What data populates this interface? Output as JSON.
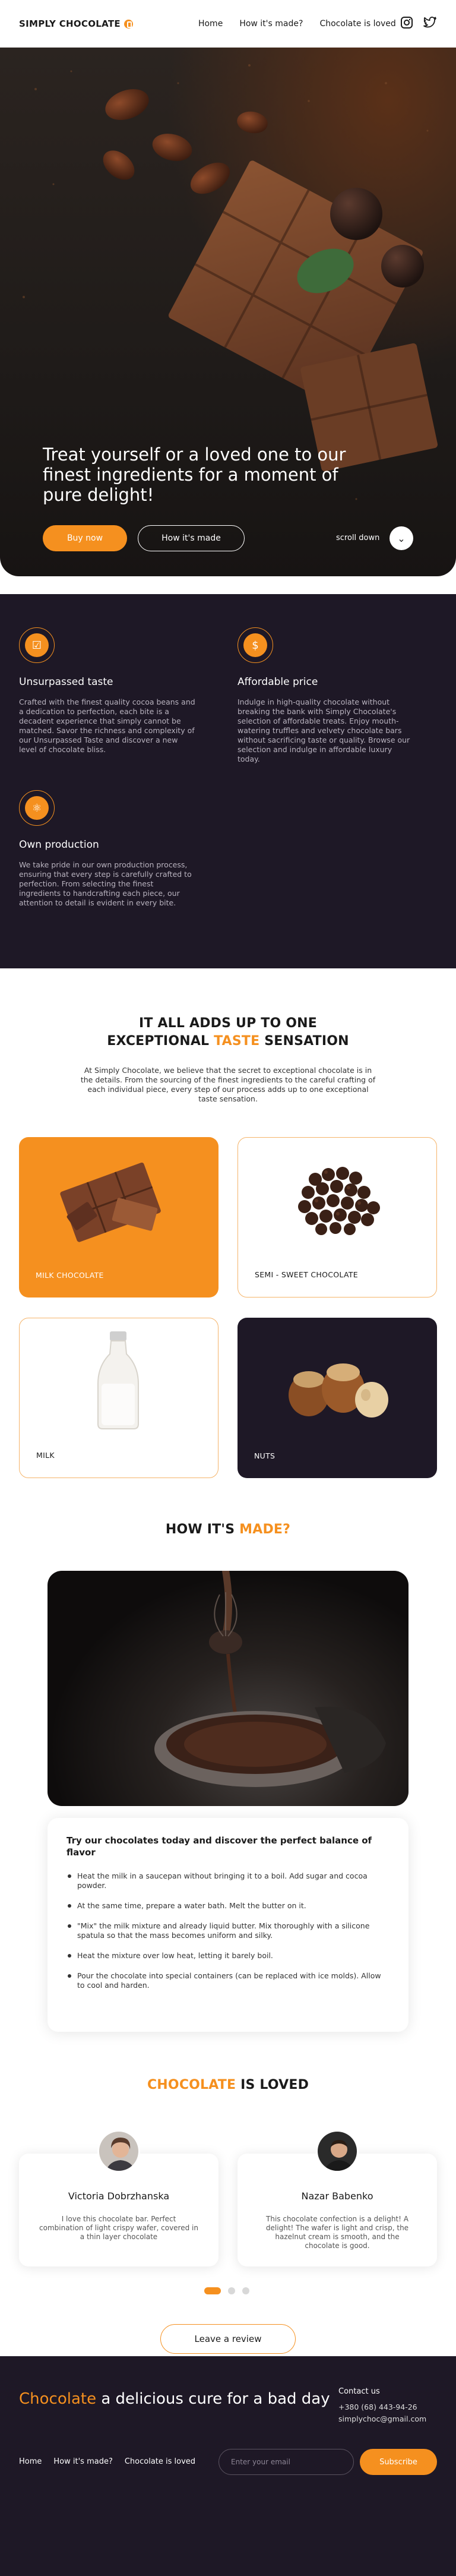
{
  "header": {
    "brand": "SIMPLY CHOCOLATE",
    "nav": [
      "Home",
      "How it's made?",
      "Chocolate is loved"
    ],
    "socials": [
      "instagram-icon",
      "twitter-icon"
    ]
  },
  "hero": {
    "title": "Treat yourself or a loved one to our finest ingredients for a moment of pure delight!",
    "buy_label": "Buy now",
    "how_label": "How it's made",
    "scroll_label": "scroll down"
  },
  "features": [
    {
      "icon": "shield-icon",
      "title": "Unsurpassed taste",
      "text": "Crafted with the finest quality cocoa beans and a dedication to perfection, each bite is a decadent experience that simply cannot be matched. Savor the richness and complexity of our Unsurpassed Taste and discover a new level of chocolate bliss."
    },
    {
      "icon": "dollar-icon",
      "title": "Affordable price",
      "text": "Indulge in high-quality chocolate without breaking the bank with Simply Chocolate's selection of affordable treats. Enjoy mouth-watering truffles and velvety chocolate bars without sacrificing taste or quality. Browse our selection and indulge in affordable luxury today."
    },
    {
      "icon": "whisk-icon",
      "title": "Own production",
      "text": "We take pride in our own production process, ensuring that every step is carefully crafted to perfection. From selecting the finest ingredients to handcrafting each piece, our attention to detail is evident in every bite."
    }
  ],
  "adds_up": {
    "title_line1": "IT ALL ADDS UP TO ONE",
    "title_line2_pre": "EXCEPTIONAL ",
    "title_line2_accent": "TASTE",
    "title_line2_post": " SENSATION",
    "text": "At Simply Chocolate, we believe that the secret to exceptional chocolate is in the details. From the sourcing of the finest ingredients to the careful crafting of each individual piece, every step of our process adds up to one exceptional taste sensation.",
    "cards": [
      "MILK CHOCOLATE",
      "SEMI - SWEET CHOCOLATE",
      "MILK",
      "NUTS"
    ]
  },
  "how_made": {
    "title_pre": "HOW IT'S ",
    "title_accent": "MADE?",
    "card_title": "Try  our chocolates today and discover the perfect balance of flavor",
    "steps": [
      "Heat the milk in a saucepan without bringing it to a boil. Add sugar and cocoa powder.",
      "At the same time, prepare a water bath. Melt the butter on it.",
      "\"Mix\" the milk mixture and already liquid butter. Mix thoroughly with a silicone spatula so that the mass becomes uniform and silky.",
      "Heat the mixture over low heat, letting it barely boil.",
      "Pour the chocolate into special containers (can be replaced with ice molds). Allow to cool and harden."
    ]
  },
  "loved": {
    "title_accent": "CHOCOLATE",
    "title_post": " IS LOVED",
    "reviews": [
      {
        "name": "Victoria Dobrzhanska",
        "quote": "I love this chocolate bar. Perfect combination of light crispy wafer, covered in a thin layer chocolate"
      },
      {
        "name": "Nazar Babenko",
        "quote": "This chocolate confection is a delight! A delight! The wafer is light and crisp, the hazelnut cream is smooth, and the chocolate is good."
      }
    ],
    "review_button": "Leave a review"
  },
  "footer": {
    "title_accent": "Chocolate",
    "title_rest": " a delicious cure for a bad day",
    "contact_label": "Contact us",
    "phone": "+380 (68) 443-94-26",
    "email": "simplychoc@gmail.com",
    "nav": [
      "Home",
      "How it's made?",
      "Chocolate is loved"
    ],
    "email_placeholder": "Enter your email",
    "subscribe_label": "Subscribe"
  },
  "colors": {
    "accent": "#f5901f",
    "dark": "#1e1826"
  }
}
